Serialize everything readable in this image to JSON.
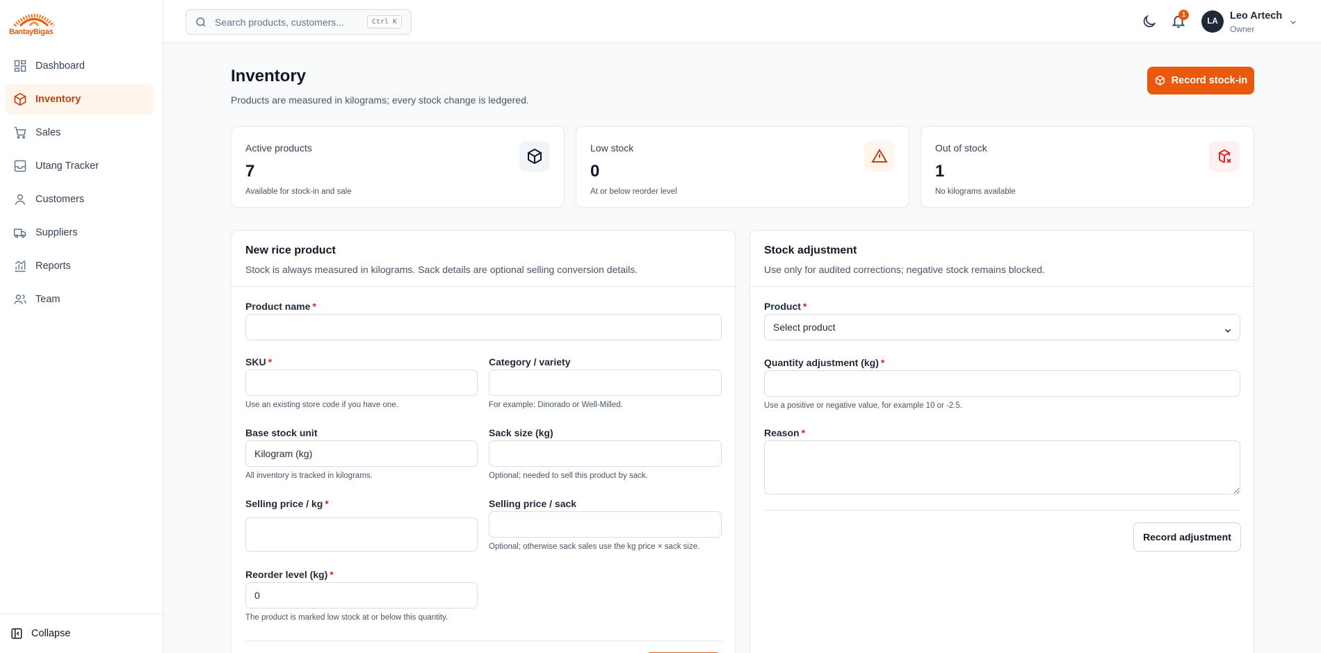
{
  "brand": {
    "name": "BantayBigas",
    "accent": "#ea580c"
  },
  "sidebar": {
    "items": [
      {
        "label": "Dashboard",
        "icon": "dashboard-icon"
      },
      {
        "label": "Inventory",
        "icon": "inventory-box-icon",
        "active": true
      },
      {
        "label": "Sales",
        "icon": "cart-icon"
      },
      {
        "label": "Utang Tracker",
        "icon": "ledger-icon"
      },
      {
        "label": "Customers",
        "icon": "customer-icon"
      },
      {
        "label": "Suppliers",
        "icon": "truck-icon"
      },
      {
        "label": "Reports",
        "icon": "reports-icon"
      },
      {
        "label": "Team",
        "icon": "team-icon"
      }
    ],
    "collapse_label": "Collapse"
  },
  "topbar": {
    "search_placeholder": "Search products, customers...",
    "search_shortcut": "Ctrl K",
    "notification_count": "1",
    "user": {
      "initials": "LA",
      "name": "Leo Artech",
      "role": "Owner"
    }
  },
  "page": {
    "title": "Inventory",
    "subtitle": "Products are measured in kilograms; every stock change is ledgered.",
    "primary_action": "Record stock-in"
  },
  "stats": [
    {
      "label": "Active products",
      "value": "7",
      "note": "Available for stock-in and sale",
      "icon": "package-icon"
    },
    {
      "label": "Low stock",
      "value": "0",
      "note": "At or below reorder level",
      "icon": "warning-icon"
    },
    {
      "label": "Out of stock",
      "value": "1",
      "note": "No kilograms available",
      "icon": "package-x-icon"
    }
  ],
  "new_product": {
    "title": "New rice product",
    "subtitle": "Stock is always measured in kilograms. Sack details are optional selling conversion details.",
    "product_name": {
      "label": "Product name",
      "value": ""
    },
    "sku": {
      "label": "SKU",
      "value": "",
      "help": "Use an existing store code if you have one."
    },
    "category": {
      "label": "Category / variety",
      "value": "",
      "help": "For example: Dinorado or Well-Milled."
    },
    "base_unit": {
      "label": "Base stock unit",
      "value": "Kilogram (kg)",
      "help": "All inventory is tracked in kilograms."
    },
    "sack_size": {
      "label": "Sack size (kg)",
      "value": "",
      "help": "Optional; needed to sell this product by sack."
    },
    "price_kg": {
      "label": "Selling price / kg",
      "value": ""
    },
    "price_sack": {
      "label": "Selling price / sack",
      "value": "",
      "help": "Optional; otherwise sack sales use the kg price × sack size."
    },
    "reorder": {
      "label": "Reorder level (kg)",
      "value": "0",
      "help": "The product is marked low stock at or below this quantity."
    }
  },
  "stock_adjustment": {
    "title": "Stock adjustment",
    "subtitle": "Use only for audited corrections; negative stock remains blocked.",
    "product": {
      "label": "Product",
      "selected": "Select product"
    },
    "quantity": {
      "label": "Quantity adjustment (kg)",
      "value": "",
      "help": "Use a positive or negative value, for example 10 or -2.5."
    },
    "reason": {
      "label": "Reason",
      "value": ""
    },
    "button": "Record adjustment"
  }
}
